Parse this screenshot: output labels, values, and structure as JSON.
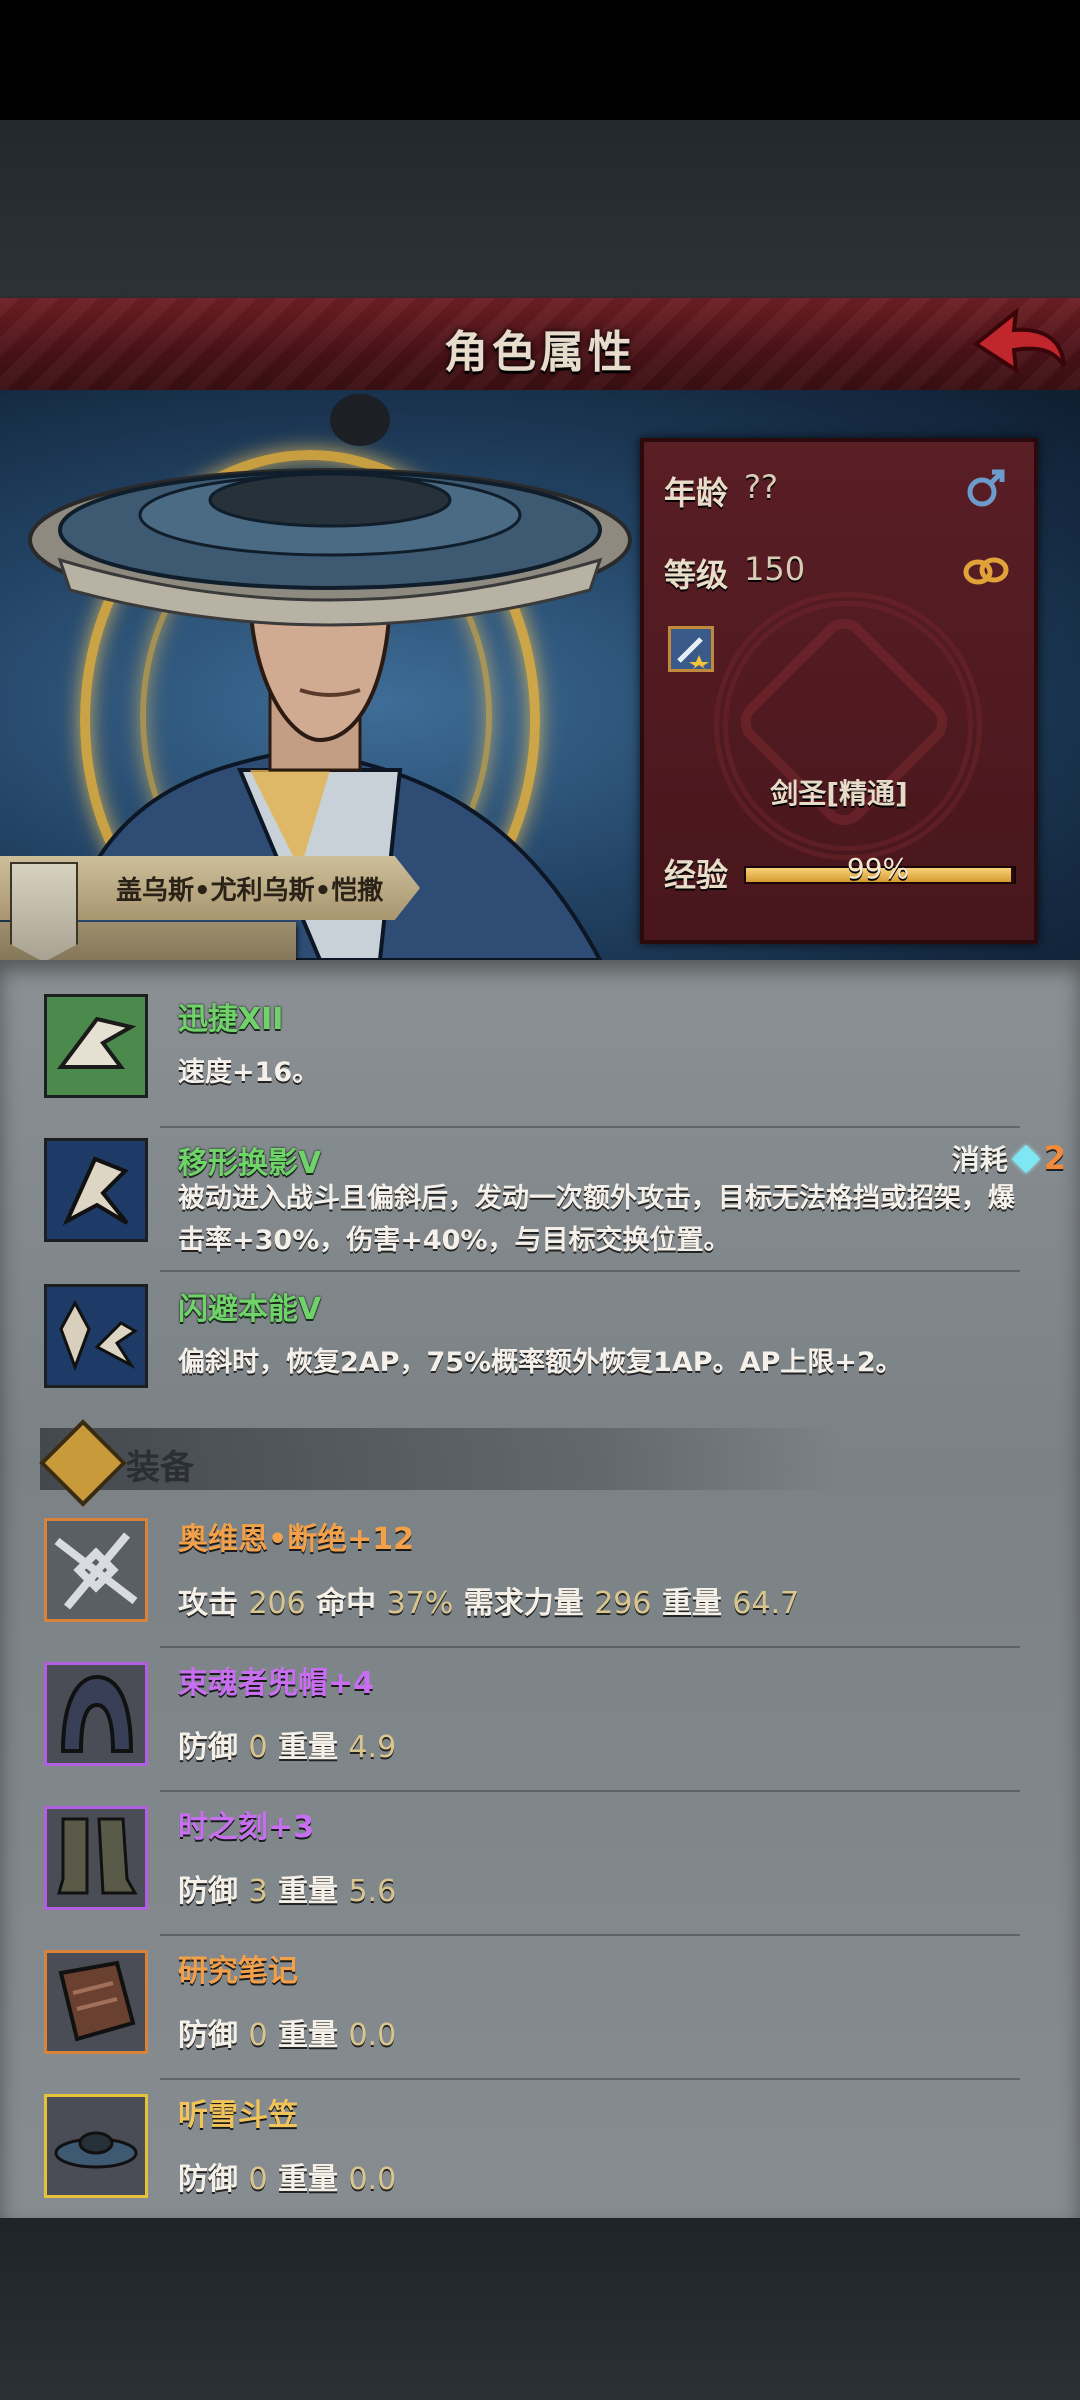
{
  "header": {
    "title": "角色属性"
  },
  "character": {
    "name": "盖乌斯•尤利乌斯•恺撒",
    "age_label": "年龄",
    "age_value": "??",
    "level_label": "等级",
    "level_value": "150",
    "class_name": "剑圣[精通]",
    "exp_label": "经验",
    "exp_percent": "99%",
    "exp_fraction": 0.99
  },
  "skills": [
    {
      "name": "迅捷XII",
      "desc": "速度+16。"
    },
    {
      "name": "移形换影V",
      "desc": "被动进入战斗且偏斜后，发动一次额外攻击，目标无法格挡或招架，爆击率+30%，伤害+40%，与目标交换位置。",
      "cost_label": "消耗",
      "cost_value": "2"
    },
    {
      "name": "闪避本能V",
      "desc": "偏斜时，恢复2AP，75%概率额外恢复1AP。AP上限+2。"
    }
  ],
  "equipment_title": "装备",
  "equipment": [
    {
      "name": "奥维恩•断绝+12",
      "s1": "攻击",
      "v1": "206",
      "s2": "命中",
      "v2": "37%",
      "s3": "需求力量",
      "v3": "296",
      "s4": "重量",
      "v4": "64.7"
    },
    {
      "name": "束魂者兜帽+4",
      "s1": "防御",
      "v1": "0",
      "s2": "重量",
      "v2": "4.9"
    },
    {
      "name": "时之刻+3",
      "s1": "防御",
      "v1": "3",
      "s2": "重量",
      "v2": "5.6"
    },
    {
      "name": "研究笔记",
      "s1": "防御",
      "v1": "0",
      "s2": "重量",
      "v2": "0.0"
    },
    {
      "name": "听雪斗笠",
      "s1": "防御",
      "v1": "0",
      "s2": "重量",
      "v2": "0.0"
    }
  ],
  "colors": {
    "skill_name": "#6fd36a",
    "rarity_orange": "#f2a04a",
    "rarity_purple": "#c86ef0",
    "rarity_gold": "#f0c45a"
  },
  "icons": [
    "back-arrow-icon",
    "male-icon",
    "rings-icon",
    "sword-star-icon",
    "gem-icon",
    "cross-emblem-icon"
  ]
}
